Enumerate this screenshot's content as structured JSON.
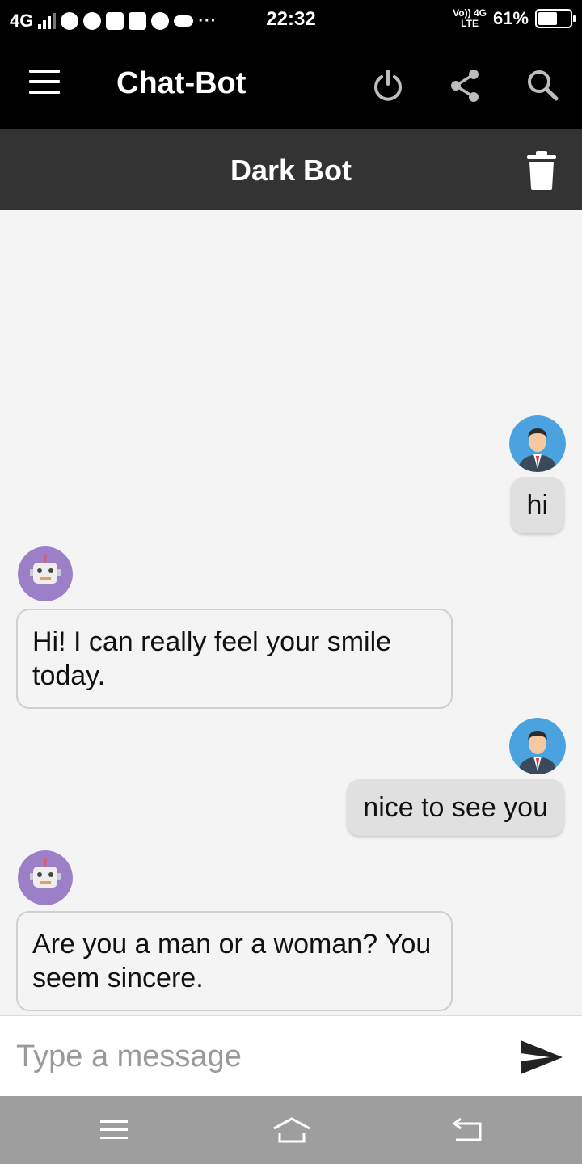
{
  "status_bar": {
    "network": "4G",
    "time": "22:32",
    "volte_top": "Vo)) 4G",
    "volte_bottom": "LTE",
    "battery_percent_label": "61%",
    "battery_level": 0.61
  },
  "app_bar": {
    "title": "Chat-Bot",
    "icons": [
      "menu-icon",
      "power-icon",
      "share-icon",
      "search-icon"
    ]
  },
  "sub_header": {
    "title": "Dark Bot",
    "icon": "trash-icon"
  },
  "messages": [
    {
      "sender": "user",
      "text": "hi"
    },
    {
      "sender": "bot",
      "text": "Hi!  I can really feel your smile today."
    },
    {
      "sender": "user",
      "text": "nice to see you"
    },
    {
      "sender": "bot",
      "text": "Are you a man or a woman? You seem sincere."
    }
  ],
  "input": {
    "placeholder": "Type a message",
    "value": "",
    "send_icon": "send-icon"
  },
  "nav_bar": {
    "icons": [
      "recents-icon",
      "home-icon",
      "back-icon"
    ]
  },
  "colors": {
    "app_bar": "#000000",
    "sub_header": "#333333",
    "chat_bg": "#f4f4f4",
    "user_bubble": "#e0e0e0",
    "bot_avatar": "#9b7fc7",
    "user_avatar": "#4aa3df",
    "nav_bar": "#9e9e9e"
  }
}
